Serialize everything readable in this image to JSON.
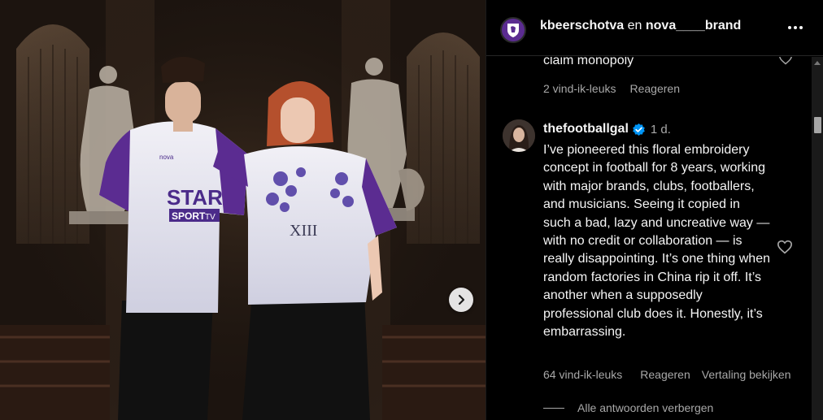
{
  "post": {
    "author": "kbeerschotva",
    "connector": "en",
    "collaborator": "nova____brand",
    "more_icon": "more-options-icon"
  },
  "photo": {
    "next_icon": "chevron-right-icon",
    "shirt_text_star": "STAR",
    "shirt_text_sport": "SPORT",
    "shirt_text_tv": "TV",
    "shirt_text_nova": "nova",
    "shirt_text_roman": "XIII"
  },
  "previous_comment": {
    "text": "claim monopoly",
    "likes": "2 vind-ik-leuks",
    "reply": "Reageren"
  },
  "comment": {
    "user": "thefootballgal",
    "verified": true,
    "time": "1 d.",
    "text": "I’ve pioneered this floral embroidery concept in football for 8 years, working with major brands, clubs, footballers, and musicians. Seeing it copied in such a bad, lazy and uncreative way — with no credit or collaboration — is really disappointing. It’s one thing when random factories in China rip it off. It’s another when a supposedly professional club does it. Honestly, it’s embarrassing.",
    "likes": "64 vind-ik-leuks",
    "reply": "Reageren",
    "translate": "Vertaling bekijken",
    "hide_replies": "Alle antwoorden verbergen"
  },
  "colors": {
    "background": "#000000",
    "text": "#f5f5f5",
    "secondary": "#a8a8a8",
    "verified": "#0095f6",
    "club_purple": "#5b2c91"
  }
}
